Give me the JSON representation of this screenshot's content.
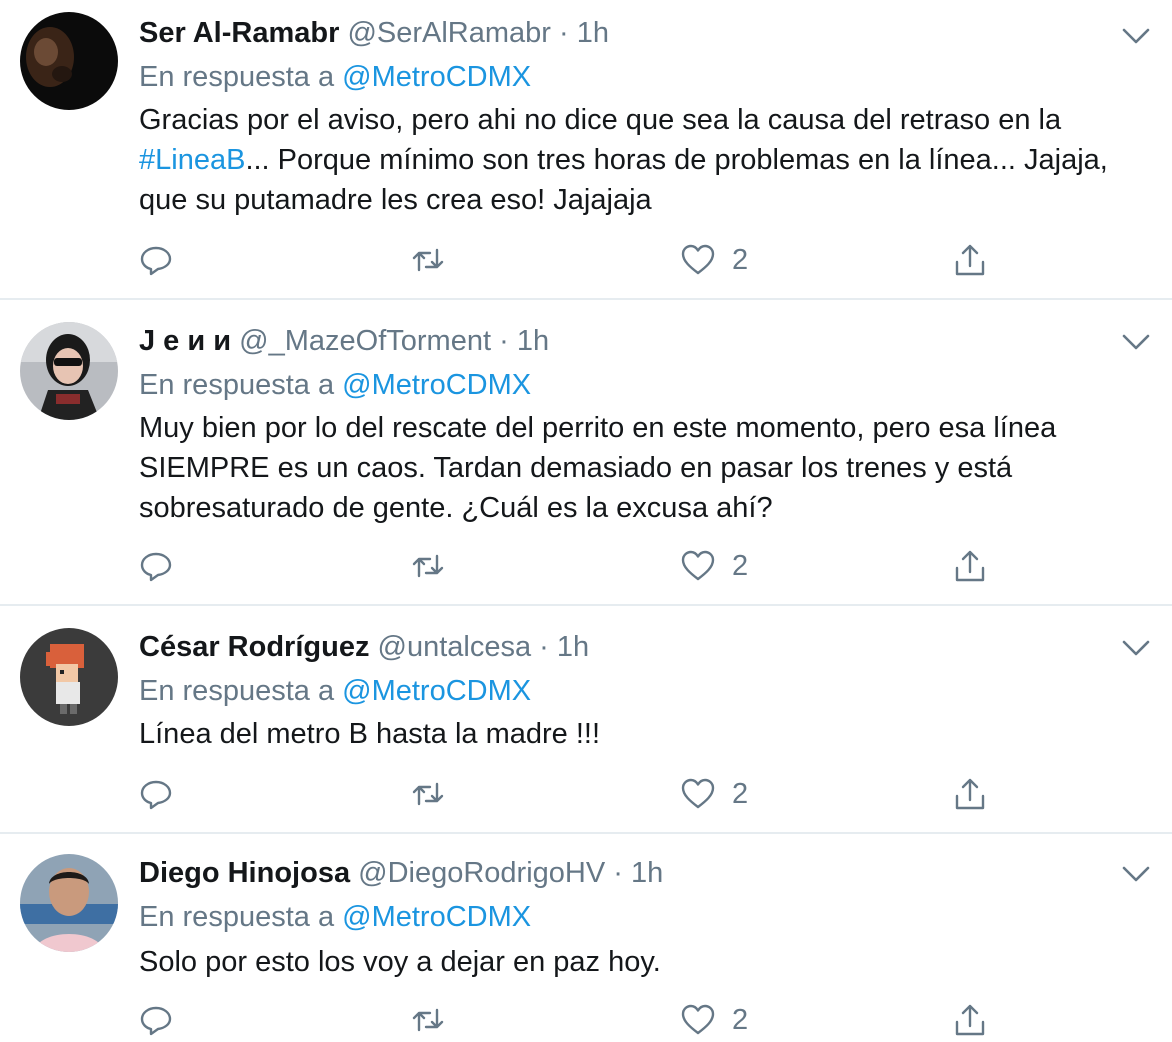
{
  "colors": {
    "link": "#1b95e0",
    "muted": "#657786",
    "text": "#14171a",
    "divider": "#e6ecf0"
  },
  "tweets": [
    {
      "name": "Ser Al-Ramabr",
      "handle": "@SerAlRamabr",
      "separator": "·",
      "time": "1h",
      "reply_prefix": "En respuesta a",
      "reply_to": "@MetroCDMX",
      "body_segments": [
        {
          "text": "Gracias por el aviso, pero ahi no dice que sea la causa del retraso en la ",
          "type": "text"
        },
        {
          "text": "#LineaB",
          "type": "hashtag"
        },
        {
          "text": "... Porque mínimo son tres horas de problemas en la línea... Jajaja, que su putamadre les crea eso! Jajajaja",
          "type": "text"
        }
      ],
      "like_count": "2",
      "avatar_icon": "dark-face-avatar"
    },
    {
      "name": "J e и и",
      "handle": "@_MazeOfTorment",
      "separator": "·",
      "time": "1h",
      "reply_prefix": "En respuesta a",
      "reply_to": "@MetroCDMX",
      "body_segments": [
        {
          "text": "Muy bien por lo del rescate del perrito en este momento, pero esa línea SIEMPRE es un caos. Tardan demasiado en pasar los trenes y está sobresaturado de gente. ¿Cuál es la excusa ahí?",
          "type": "text"
        }
      ],
      "like_count": "2",
      "avatar_icon": "sunglasses-person-avatar"
    },
    {
      "name": "César Rodríguez",
      "handle": "@untalcesa",
      "separator": "·",
      "time": "1h",
      "reply_prefix": "En respuesta a",
      "reply_to": "@MetroCDMX",
      "body_segments": [
        {
          "text": "Línea del metro B hasta la madre !!!",
          "type": "text"
        }
      ],
      "like_count": "2",
      "avatar_icon": "pixel-character-avatar"
    },
    {
      "name": "Diego Hinojosa",
      "handle": "@DiegoRodrigoHV",
      "separator": "·",
      "time": "1h",
      "reply_prefix": "En respuesta a",
      "reply_to": "@MetroCDMX",
      "body_segments": [
        {
          "text": "Solo por esto los voy a dejar en paz hoy.",
          "type": "text"
        }
      ],
      "like_count": "2",
      "avatar_icon": "man-portrait-avatar"
    }
  ]
}
